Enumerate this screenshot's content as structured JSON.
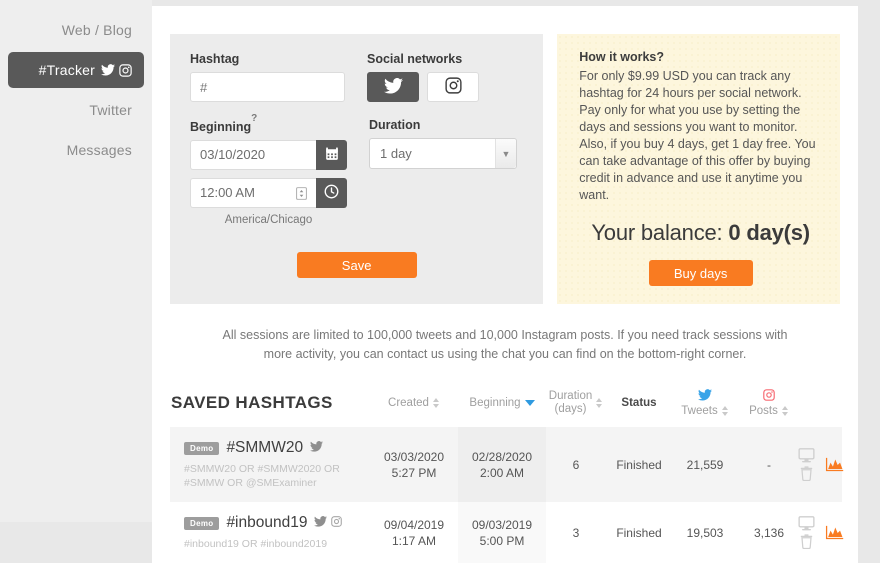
{
  "sidebar": {
    "items": [
      {
        "label": "Web / Blog",
        "icons": [],
        "active": false
      },
      {
        "label": "#Tracker",
        "icons": [
          "twitter-icon",
          "instagram-icon"
        ],
        "active": true
      },
      {
        "label": "Twitter",
        "icons": [],
        "active": false
      },
      {
        "label": "Messages",
        "icons": [],
        "active": false
      }
    ]
  },
  "form": {
    "hashtag_label": "Hashtag",
    "hashtag_value": "",
    "hashtag_placeholder": "#",
    "networks_label": "Social networks",
    "networks": [
      {
        "name": "twitter-icon",
        "selected": true
      },
      {
        "name": "instagram-icon",
        "selected": false
      }
    ],
    "beginning_label": "Beginning",
    "beginning_help": "?",
    "date_value": "03/10/2020",
    "time_value": "12:00 AM",
    "timezone": "America/Chicago",
    "duration_label": "Duration",
    "duration_value": "1 day",
    "save_label": "Save"
  },
  "info": {
    "title": "How it works?",
    "paragraphs": [
      "For only $9.99 USD you can track any hashtag for 24 hours per social network.",
      "Pay only for what you use by setting the days and sessions you want to monitor.",
      "Also, if you buy 4 days, get 1 day free. You can take advantage of this offer by buying credit in advance and use it anytime you want."
    ],
    "balance_prefix": "Your balance: ",
    "balance_value": "0 day(s)",
    "buy_label": "Buy days"
  },
  "note": "All sessions are limited to 100,000 tweets and 10,000 Instagram posts. If you need track sessions with more activity, you can contact us using the chat you can find on the bottom-right corner.",
  "table": {
    "title": "SAVED HASHTAGS",
    "columns": [
      {
        "label": "Created",
        "sort": "none"
      },
      {
        "label": "Beginning",
        "sort": "desc"
      },
      {
        "label": "Duration",
        "sublabel": "(days)",
        "sort": "none"
      },
      {
        "label": "Status",
        "sort": "none"
      },
      {
        "label": "Tweets",
        "icon": "twitter-icon",
        "sort": "none"
      },
      {
        "label": "Posts",
        "icon": "instagram-icon",
        "sort": "none"
      },
      {
        "label": "",
        "sort": "none"
      }
    ],
    "rows": [
      {
        "badge": "Demo",
        "hashtag": "#SMMW20",
        "networks": [
          "twitter-icon"
        ],
        "query": "#SMMW20 OR #SMMW2020 OR #SMMW OR @SMExaminer",
        "created_date": "03/03/2020",
        "created_time": "5:27 PM",
        "beginning_date": "02/28/2020",
        "beginning_time": "2:00 AM",
        "duration": "6",
        "status": "Finished",
        "tweets": "21,559",
        "posts": "-"
      },
      {
        "badge": "Demo",
        "hashtag": "#inbound19",
        "networks": [
          "twitter-icon",
          "instagram-icon"
        ],
        "query": "#inbound19 OR #inbound2019",
        "created_date": "09/04/2019",
        "created_time": "1:17 AM",
        "beginning_date": "09/03/2019",
        "beginning_time": "5:00 PM",
        "duration": "3",
        "status": "Finished",
        "tweets": "19,503",
        "posts": "3,136"
      }
    ],
    "action_icons": [
      "monitor-icon",
      "trash-icon",
      "chart-icon"
    ]
  },
  "colors": {
    "accent_orange": "#f97b21",
    "dark_gray": "#595959",
    "panel_yellow": "#fdf6dd",
    "twitter_blue": "#3aa4e8",
    "instagram_pink": "#f76c74",
    "sort_active_blue": "#2f9ae0"
  }
}
